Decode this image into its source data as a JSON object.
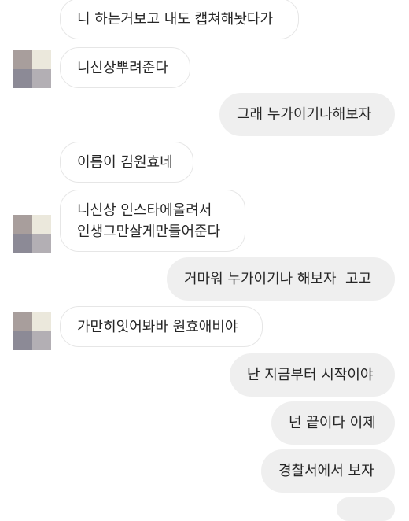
{
  "messages": [
    {
      "side": "received",
      "text": "니 하는거보고 내도 캡쳐해놧다가"
    },
    {
      "side": "received",
      "text": "니신상뿌려준다"
    },
    {
      "side": "sent",
      "text": "그래 누가이기나해보자"
    },
    {
      "side": "received",
      "text": "이름이 김원효네"
    },
    {
      "side": "received",
      "lines": [
        "니신상 인스타에올려서",
        "인생그만살게만들어준다"
      ]
    },
    {
      "side": "sent",
      "text": "거마워 누가이기나 해보자  고고"
    },
    {
      "side": "received",
      "text": "가만히잇어봐바 원효애비야"
    },
    {
      "side": "sent",
      "text": "난 지금부터 시작이야"
    },
    {
      "side": "sent",
      "text": "넌 끝이다 이제"
    },
    {
      "side": "sent",
      "text": "경찰서에서 보자"
    },
    {
      "side": "sent",
      "text": ""
    }
  ],
  "colors": {
    "received_bubble_bg": "#ffffff",
    "received_bubble_border": "#e6e6e6",
    "sent_bubble_bg": "#efefef",
    "text": "#262626",
    "avatar_pixels": [
      "#a89e9c",
      "#ebe8dc",
      "#8c8a96",
      "#b3afb4"
    ]
  }
}
